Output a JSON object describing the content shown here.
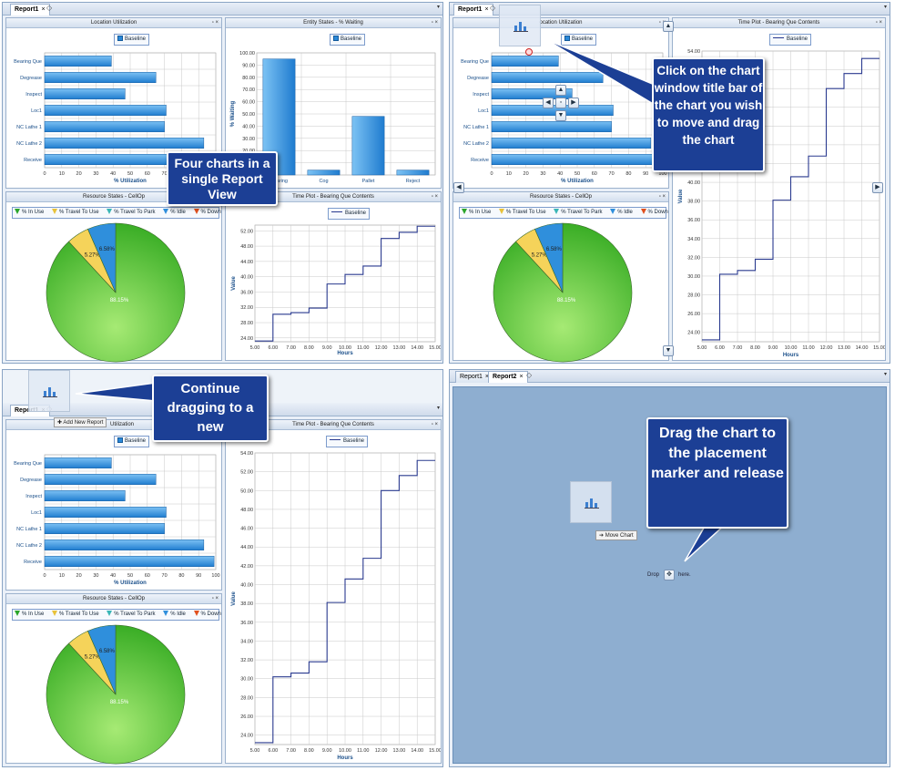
{
  "tabs": {
    "report1": "Report1",
    "report2": "Report2",
    "close": "×",
    "add": "◇",
    "menu": "▾"
  },
  "panels": {
    "location": "Location Utilization",
    "location_short": "ocation Utilization",
    "location_short2": "Utilization",
    "entity": "Entity States - % Waiting",
    "resource": "Resource States - CellOp",
    "timeplot": "Time Plot - Bearing Que Contents",
    "timeplot_short": "Time Plot - Bearing Que Contents",
    "window_ctrl": "▫ ×"
  },
  "legend": {
    "baseline": "Baseline",
    "in_use": "% In Use",
    "travel_to_use": "% Travel To Use",
    "travel_to_park": "% Travel To Park",
    "idle": "% Idle",
    "down": "% Down"
  },
  "location_chart": {
    "categories": [
      "Bearing Que",
      "Degrease",
      "Inspect",
      "Loc1",
      "NC Lathe 1",
      "NC Lathe 2",
      "Receive"
    ],
    "values": [
      39,
      65,
      47,
      71,
      70,
      93,
      99
    ],
    "xlabel": "% Utilization",
    "xticks": [
      "0",
      "10",
      "20",
      "30",
      "40",
      "50",
      "60",
      "70",
      "80",
      "90",
      "100"
    ],
    "xlim": [
      0,
      100
    ]
  },
  "entity_chart": {
    "categories": [
      "Bearing",
      "Cog",
      "Pallet",
      "Reject"
    ],
    "values": [
      95,
      4,
      48,
      4
    ],
    "ylabel": "% Waiting",
    "yticks": [
      "100.00",
      "90.00",
      "80.00",
      "70.00",
      "60.00",
      "50.00",
      "40.00",
      "30.00",
      "20.00",
      "10.00",
      "0.00"
    ],
    "ylim": [
      0,
      100
    ]
  },
  "pie_chart": {
    "slices": [
      {
        "name": "% In Use",
        "value": 88.15,
        "label": "88.15%",
        "color": "#4cbf2c"
      },
      {
        "name": "% Travel To Use",
        "value": 5.27,
        "label": "5.27%",
        "color": "#f5d35a"
      },
      {
        "name": "% Idle",
        "value": 6.58,
        "label": "6.58%",
        "color": "#2f8fdc"
      }
    ]
  },
  "time_chart": {
    "ylabel": "Value",
    "xlabel": "Hours",
    "xticks": [
      "5.00",
      "6.00",
      "7.00",
      "8.00",
      "9.00",
      "10.00",
      "11.00",
      "12.00",
      "13.00",
      "14.00",
      "15.00"
    ],
    "yticks_small": [
      "52.00",
      "48.00",
      "44.00",
      "40.00",
      "36.00",
      "32.00",
      "28.00",
      "24.00"
    ],
    "yticks_large": [
      "54.00",
      "52.00",
      "50.00",
      "48.00",
      "46.00",
      "44.00",
      "42.00",
      "40.00",
      "38.00",
      "36.00",
      "34.00",
      "32.00",
      "30.00",
      "28.00",
      "26.00",
      "24.00"
    ],
    "xlim": [
      5,
      15
    ],
    "ylim_large": [
      23,
      54
    ],
    "ylim_small": [
      23,
      53.5
    ],
    "steps": [
      [
        5,
        23.2
      ],
      [
        6,
        30.2
      ],
      [
        7,
        30.6
      ],
      [
        8,
        31.8
      ],
      [
        9,
        38.1
      ],
      [
        10,
        40.6
      ],
      [
        11,
        42.8
      ],
      [
        12,
        50
      ],
      [
        13,
        51.6
      ],
      [
        14,
        53.2
      ],
      [
        15,
        53.2
      ]
    ]
  },
  "callouts": {
    "four_charts": "Four charts in a single Report View",
    "click_title": "Click on the chart window title bar of the chart you wish to move and drag the chart",
    "continue": "Continue dragging to a new",
    "drag_marker": "Drag the chart to the placement marker and release"
  },
  "tooltips": {
    "add_new_report": "Add New Report",
    "move_chart": "Move Chart",
    "drop": "Drop",
    "here": "here."
  },
  "colors": {
    "bar": "#2a88d8",
    "callout": "#1c3f95",
    "step_line": "#2a3a8f",
    "dropzone": "#8eaed0"
  }
}
